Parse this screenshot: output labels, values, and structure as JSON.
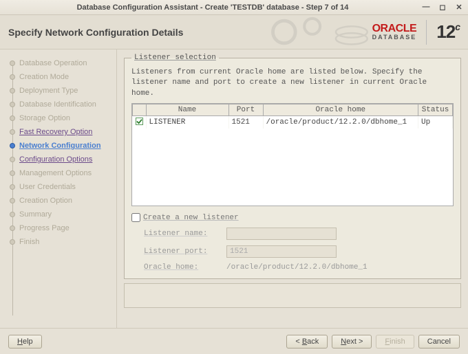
{
  "window": {
    "title": "Database Configuration Assistant - Create 'TESTDB' database - Step 7 of 14"
  },
  "header": {
    "title": "Specify Network Configuration Details",
    "brand_name": "ORACLE",
    "brand_sub": "DATABASE",
    "brand_version": "12",
    "brand_suffix": "c"
  },
  "sidebar": {
    "steps": [
      {
        "label": "Database Operation",
        "state": "disabled"
      },
      {
        "label": "Creation Mode",
        "state": "disabled"
      },
      {
        "label": "Deployment Type",
        "state": "disabled"
      },
      {
        "label": "Database Identification",
        "state": "disabled"
      },
      {
        "label": "Storage Option",
        "state": "disabled"
      },
      {
        "label": "Fast Recovery Option",
        "state": "linked"
      },
      {
        "label": "Network Configuration",
        "state": "current"
      },
      {
        "label": "Configuration Options",
        "state": "linked"
      },
      {
        "label": "Management Options",
        "state": "disabled"
      },
      {
        "label": "User Credentials",
        "state": "disabled"
      },
      {
        "label": "Creation Option",
        "state": "disabled"
      },
      {
        "label": "Summary",
        "state": "disabled"
      },
      {
        "label": "Progress Page",
        "state": "disabled"
      },
      {
        "label": "Finish",
        "state": "disabled"
      }
    ]
  },
  "panel": {
    "legend": "Listener selection",
    "desc": "Listeners from current Oracle home are listed below. Specify the listener name and port to create a new listener in current Oracle home.",
    "columns": {
      "c0": "",
      "c1": "Name",
      "c2": "Port",
      "c3": "Oracle home",
      "c4": "Status"
    },
    "rows": [
      {
        "checked": true,
        "name": "LISTENER",
        "port": "1521",
        "home": "/oracle/product/12.2.0/dbhome_1",
        "status": "Up"
      }
    ],
    "create_new_label": "Create a new listener",
    "listener_name_label": "Listener name:",
    "listener_name_value": "",
    "listener_port_label": "Listener port:",
    "listener_port_value": "1521",
    "oracle_home_label": "Oracle home:",
    "oracle_home_value": "/oracle/product/12.2.0/dbhome_1"
  },
  "footer": {
    "help": "Help",
    "back": "< Back",
    "next": "Next >",
    "finish": "Finish",
    "cancel": "Cancel"
  }
}
